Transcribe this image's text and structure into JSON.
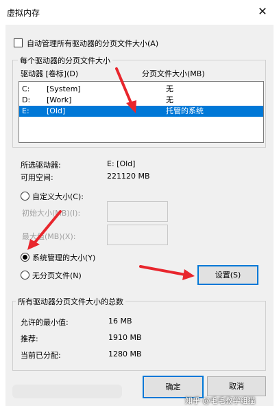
{
  "window": {
    "title": "虚拟内存",
    "close_glyph": "✕"
  },
  "auto_manage": {
    "label": "自动管理所有驱动器的分页文件大小(A)",
    "checked": false
  },
  "drive_group": {
    "title": "每个驱动器的分页文件大小",
    "col_drive": "驱动器 [卷标](D)",
    "col_size": "分页文件大小(MB)",
    "rows": [
      {
        "drive": "C:",
        "label": "[System]",
        "size": "无"
      },
      {
        "drive": "D:",
        "label": "[Work]",
        "size": "无"
      },
      {
        "drive": "E:",
        "label": "[Old]",
        "size": "托管的系统"
      }
    ]
  },
  "selected": {
    "drive_label": "所选驱动器:",
    "drive_value": "E:  [Old]",
    "space_label": "可用空间:",
    "space_value": "221120 MB"
  },
  "options": {
    "custom_label": "自定义大小(C):",
    "initial_label": "初始大小(MB)(I):",
    "max_label": "最大值(MB)(X):",
    "system_label": "系统管理的大小(Y)",
    "none_label": "无分页文件(N)",
    "set_button": "设置(S)"
  },
  "totals": {
    "title": "所有驱动器分页文件大小的总数",
    "min_label": "允许的最小值:",
    "min_value": "16 MB",
    "rec_label": "推荐:",
    "rec_value": "1910 MB",
    "cur_label": "当前已分配:",
    "cur_value": "1280 MB"
  },
  "buttons": {
    "ok": "确定",
    "cancel": "取消"
  },
  "watermark": "知乎 @毛毛教学组猫",
  "colors": {
    "selection": "#0078d7",
    "annotation_arrow": "#e8262d"
  }
}
